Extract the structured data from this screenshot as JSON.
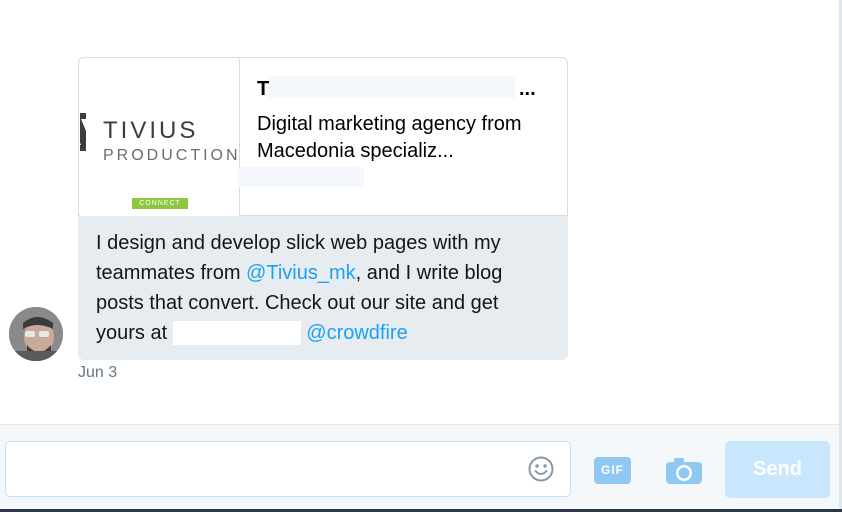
{
  "card": {
    "thumbnail": {
      "logo_line1": "TIVIUS",
      "logo_line2": "PRODUCTION",
      "badge": "CONNECT"
    },
    "preview_title_start": "T",
    "preview_title_end": "...",
    "preview_description": "Digital marketing agency from Macedonia specializ...",
    "body": {
      "line1": "I design and develop slick web pages with my",
      "line2_start": "teammates from ",
      "line2_mention": "@Tivius_mk",
      "line2_end": ", and I write blog",
      "line3": "posts that convert. Check out our site and get",
      "line4_start": "yours at ",
      "line4_mention": "@crowdfire"
    }
  },
  "timestamp": "Jun 3",
  "composer": {
    "message_value": "",
    "gif_label": "GIF",
    "send_label": "Send"
  },
  "icons": {
    "emoji": "smiley-face-icon",
    "camera": "camera-icon"
  },
  "colors": {
    "link": "#1da1f2",
    "send_disabled": "#c9e7fc",
    "card_bg": "#e6ecf0"
  }
}
